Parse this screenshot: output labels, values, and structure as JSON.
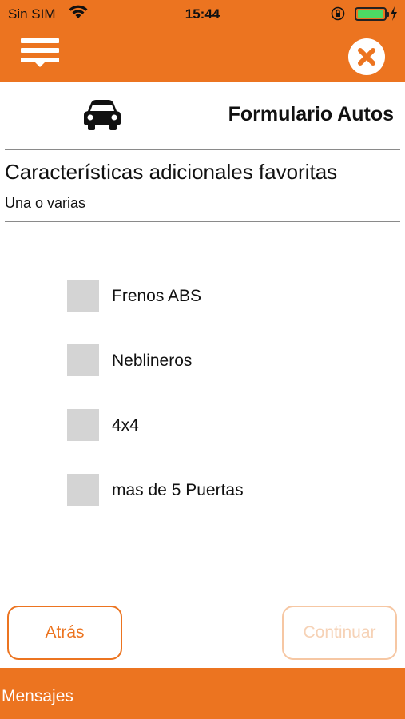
{
  "status_bar": {
    "carrier": "Sin SIM",
    "time": "15:44",
    "wifi_icon": "wifi-icon",
    "orientation_lock_icon": "orientation-lock-icon",
    "battery_icon": "battery-icon",
    "charging_icon": "bolt-icon",
    "battery_color": "#4CD964"
  },
  "nav": {
    "menu_icon": "hamburger-menu-icon",
    "close_icon": "close-icon",
    "background_color": "#EC7420"
  },
  "header": {
    "icon": "car-icon",
    "title": "Formulario Autos"
  },
  "question": {
    "title": "Características adicionales favoritas",
    "subtitle": "Una o varias"
  },
  "options": [
    {
      "label": "Frenos ABS",
      "checked": false
    },
    {
      "label": "Neblineros",
      "checked": false
    },
    {
      "label": "4x4",
      "checked": false
    },
    {
      "label": "mas de 5 Puertas",
      "checked": false
    }
  ],
  "buttons": {
    "back": "Atrás",
    "continue": "Continuar",
    "continue_enabled": false
  },
  "footer": {
    "label": "Mensajes"
  }
}
